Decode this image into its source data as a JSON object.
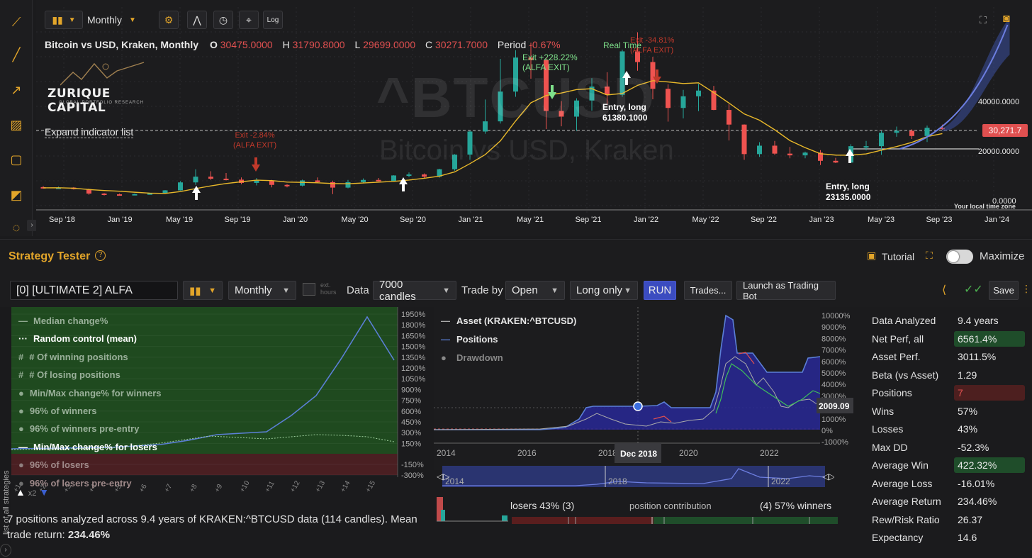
{
  "toolbar": {
    "interval": "Monthly",
    "log_label": "Log"
  },
  "symbol": {
    "title": "Bitcoin vs USD, Kraken, Monthly",
    "o_label": "O",
    "o": "30475.0000",
    "h_label": "H",
    "h": "31790.8000",
    "l_label": "L",
    "l": "29699.0000",
    "c_label": "C",
    "c": "30271.7000",
    "period_label": "Period",
    "period": "-0.67%",
    "watermark_ticker": "^BTCUSD",
    "watermark_name": "Bitcoin vs USD, Kraken"
  },
  "brand": {
    "name": "ZURIQUE CAPITAL",
    "tagline": "GLOBAL PORTFOLIO RESEARCH"
  },
  "expand_indicator": "Expand indicator list",
  "annotations": {
    "exit1": "Exit -2.84%",
    "exit1_sub": "(ALFA EXIT)",
    "exit2": "Exit +228.22%",
    "exit2_sub": "(ALFA EXIT)",
    "exit3": "Exit -34.81%",
    "exit3_sub": "(ALFA EXIT)",
    "realtime": "Real Time",
    "entry1": "Entry, long",
    "entry1_px": "61380.1000",
    "entry2": "Entry, long",
    "entry2_px": "23135.0000",
    "local_tz": "Your local time zone"
  },
  "price_axis": [
    "40000.0000",
    "20000.0000",
    "0.0000"
  ],
  "price_tag": "30,271.7",
  "time_axis": [
    "Sep '18",
    "Jan '19",
    "May '19",
    "Sep '19",
    "Jan '20",
    "May '20",
    "Sep '20",
    "Jan '21",
    "May '21",
    "Sep '21",
    "Jan '22",
    "May '22",
    "Sep '22",
    "Jan '23",
    "May '23",
    "Sep '23",
    "Jan '24"
  ],
  "strategy_tester": {
    "title": "Strategy Tester",
    "tutorial": "Tutorial",
    "maximize": "Maximize",
    "strategy_name": "[0] [ULTIMATE 2] ALFA",
    "interval": "Monthly",
    "ext_hours": "ext. hours",
    "data_label": "Data",
    "data_value": "7000 candles",
    "trade_by_label": "Trade by",
    "trade_by_value": "Open",
    "direction": "Long only",
    "run": "RUN",
    "trades": "Trades...",
    "launch": "Launch as Trading Bot",
    "save": "Save"
  },
  "dist_legend": [
    "Median change%",
    "Random control (mean)",
    "# Of winning positions",
    "# Of losing positions",
    "Min/Max change% for winners",
    "96% of winners",
    "96% of winners pre-entry",
    "Min/Max change% for losers",
    "96% of losers",
    "96% of losers pre-entry"
  ],
  "dist_yaxis": [
    "1950%",
    "1800%",
    "1650%",
    "1500%",
    "1350%",
    "1200%",
    "1050%",
    "900%",
    "750%",
    "600%",
    "450%",
    "300%",
    "150%",
    "-150%",
    "-300%"
  ],
  "dist_xaxis": [
    "+1",
    "+2",
    "+3",
    "+4",
    "+5",
    "+6",
    "+7",
    "+8",
    "+9",
    "+10",
    "+11",
    "+12",
    "+13",
    "+14",
    "+15"
  ],
  "dist_summary": "7 positions analyzed across 9.4 years of KRAKEN:^BTCUSD data (114 candles). Mean trade return:",
  "dist_mean": "234.46%",
  "vertical_tab": "list of all strategies",
  "equity": {
    "legend": [
      "Asset (KRAKEN:^BTCUSD)",
      "Positions",
      "Drawdown"
    ],
    "yaxis": [
      "10000%",
      "9000%",
      "8000%",
      "7000%",
      "6000%",
      "5000%",
      "4000%",
      "3000%",
      "2000%",
      "1000%",
      "0%",
      "-1000%"
    ],
    "xaxis": [
      "2014",
      "2016",
      "2018",
      "2020",
      "2022"
    ],
    "cursor_date": "Dec 2018",
    "cursor_value": "2009.09",
    "nav_labels": [
      "2014",
      "2018",
      "2022"
    ]
  },
  "contribution": {
    "losers": "losers 43% (3)",
    "center": "position contribution",
    "winners": "(4) 57% winners"
  },
  "stats": [
    {
      "k": "Data Analyzed",
      "v": "9.4 years"
    },
    {
      "k": "Net Perf, all",
      "v": "6561.4%"
    },
    {
      "k": "Asset Perf.",
      "v": "3011.5%"
    },
    {
      "k": "Beta (vs Asset)",
      "v": "1.29"
    },
    {
      "k": "Positions",
      "v": "7"
    },
    {
      "k": "Wins",
      "v": "57%"
    },
    {
      "k": "Losses",
      "v": "43%"
    },
    {
      "k": "Max DD",
      "v": "-52.3%"
    },
    {
      "k": "Average Win",
      "v": "422.32%"
    },
    {
      "k": "Average Loss",
      "v": "-16.01%"
    },
    {
      "k": "Average Return",
      "v": "234.46%"
    },
    {
      "k": "Rew/Risk Ratio",
      "v": "26.37"
    },
    {
      "k": "Expectancy",
      "v": "14.6"
    }
  ],
  "candles": [
    {
      "o": 6600,
      "c": 6300,
      "h": 7000,
      "l": 6000
    },
    {
      "o": 6300,
      "c": 6400,
      "h": 6800,
      "l": 6100
    },
    {
      "o": 6400,
      "c": 5800,
      "h": 6600,
      "l": 5600
    },
    {
      "o": 5800,
      "c": 4000,
      "h": 6000,
      "l": 3500
    },
    {
      "o": 4000,
      "c": 3700,
      "h": 4200,
      "l": 3200
    },
    {
      "o": 3700,
      "c": 3500,
      "h": 4000,
      "l": 3300
    },
    {
      "o": 3500,
      "c": 3800,
      "h": 4000,
      "l": 3400
    },
    {
      "o": 3800,
      "c": 4100,
      "h": 4200,
      "l": 3700
    },
    {
      "o": 4100,
      "c": 5300,
      "h": 5400,
      "l": 4000
    },
    {
      "o": 5300,
      "c": 8500,
      "h": 9000,
      "l": 5200
    },
    {
      "o": 8500,
      "c": 10800,
      "h": 13800,
      "l": 7500
    },
    {
      "o": 10800,
      "c": 10000,
      "h": 13000,
      "l": 9500
    },
    {
      "o": 10000,
      "c": 9600,
      "h": 12300,
      "l": 9300
    },
    {
      "o": 9600,
      "c": 8300,
      "h": 10500,
      "l": 7700
    },
    {
      "o": 8300,
      "c": 9200,
      "h": 10300,
      "l": 7300
    },
    {
      "o": 9200,
      "c": 7500,
      "h": 9500,
      "l": 6500
    },
    {
      "o": 7500,
      "c": 7200,
      "h": 7800,
      "l": 6500
    },
    {
      "o": 7200,
      "c": 9300,
      "h": 9600,
      "l": 6900
    },
    {
      "o": 9300,
      "c": 8600,
      "h": 10500,
      "l": 8400
    },
    {
      "o": 8600,
      "c": 6400,
      "h": 9200,
      "l": 3800
    },
    {
      "o": 6400,
      "c": 8600,
      "h": 9500,
      "l": 6100
    },
    {
      "o": 8600,
      "c": 9500,
      "h": 10100,
      "l": 8100
    },
    {
      "o": 9500,
      "c": 9100,
      "h": 10300,
      "l": 8900
    },
    {
      "o": 9100,
      "c": 11300,
      "h": 11400,
      "l": 9000
    },
    {
      "o": 11300,
      "c": 11700,
      "h": 12500,
      "l": 10600
    },
    {
      "o": 11700,
      "c": 10800,
      "h": 12100,
      "l": 10000
    },
    {
      "o": 10800,
      "c": 13800,
      "h": 14000,
      "l": 10400
    },
    {
      "o": 13800,
      "c": 19700,
      "h": 19900,
      "l": 13200
    },
    {
      "o": 19700,
      "c": 29000,
      "h": 29300,
      "l": 17600
    },
    {
      "o": 29000,
      "c": 33100,
      "h": 41900,
      "l": 28100
    },
    {
      "o": 33100,
      "c": 45100,
      "h": 58300,
      "l": 32200
    },
    {
      "o": 45100,
      "c": 58800,
      "h": 61800,
      "l": 43000
    },
    {
      "o": 58800,
      "c": 57800,
      "h": 64800,
      "l": 50300
    },
    {
      "o": 57800,
      "c": 37300,
      "h": 58800,
      "l": 30000
    },
    {
      "o": 37300,
      "c": 35000,
      "h": 41300,
      "l": 31100
    },
    {
      "o": 35000,
      "c": 41500,
      "h": 42400,
      "l": 29300
    },
    {
      "o": 41500,
      "c": 47100,
      "h": 50500,
      "l": 37400
    },
    {
      "o": 47100,
      "c": 43800,
      "h": 52900,
      "l": 39600
    },
    {
      "o": 43800,
      "c": 61300,
      "h": 62000,
      "l": 43000
    },
    {
      "o": 61300,
      "c": 57000,
      "h": 69000,
      "l": 53500
    },
    {
      "o": 57000,
      "c": 46200,
      "h": 59100,
      "l": 42000
    },
    {
      "o": 46200,
      "c": 38500,
      "h": 48000,
      "l": 33000
    },
    {
      "o": 38500,
      "c": 43200,
      "h": 45800,
      "l": 34300
    },
    {
      "o": 43200,
      "c": 45500,
      "h": 48200,
      "l": 37200
    },
    {
      "o": 45500,
      "c": 37700,
      "h": 47400,
      "l": 37600
    },
    {
      "o": 37700,
      "c": 31800,
      "h": 40000,
      "l": 25400
    },
    {
      "o": 31800,
      "c": 19900,
      "h": 31900,
      "l": 17600
    },
    {
      "o": 19900,
      "c": 23300,
      "h": 24700,
      "l": 18800
    },
    {
      "o": 23300,
      "c": 20100,
      "h": 25200,
      "l": 19600
    },
    {
      "o": 20100,
      "c": 19400,
      "h": 22800,
      "l": 18200
    },
    {
      "o": 19400,
      "c": 20500,
      "h": 20900,
      "l": 18200
    },
    {
      "o": 20500,
      "c": 17200,
      "h": 21500,
      "l": 15500
    },
    {
      "o": 17200,
      "c": 16500,
      "h": 18400,
      "l": 16300
    },
    {
      "o": 16500,
      "c": 23100,
      "h": 23900,
      "l": 16500
    },
    {
      "o": 23100,
      "c": 23100,
      "h": 25200,
      "l": 21400
    },
    {
      "o": 23100,
      "c": 28500,
      "h": 29200,
      "l": 19600
    },
    {
      "o": 28500,
      "c": 29300,
      "h": 31000,
      "l": 26900
    },
    {
      "o": 29300,
      "c": 27200,
      "h": 29900,
      "l": 26000
    },
    {
      "o": 27200,
      "c": 30500,
      "h": 31400,
      "l": 24800
    },
    {
      "o": 30500,
      "c": 30271.7,
      "h": 31790.8,
      "l": 29699
    }
  ],
  "colors": {
    "up": "#26a69a",
    "down": "#ef5350",
    "accent": "#e2a52a",
    "ma": "#e8b82a",
    "run": "#3b4cc0",
    "green_stat": "#1f4d2a",
    "red_stat": "#4d1f1f"
  }
}
